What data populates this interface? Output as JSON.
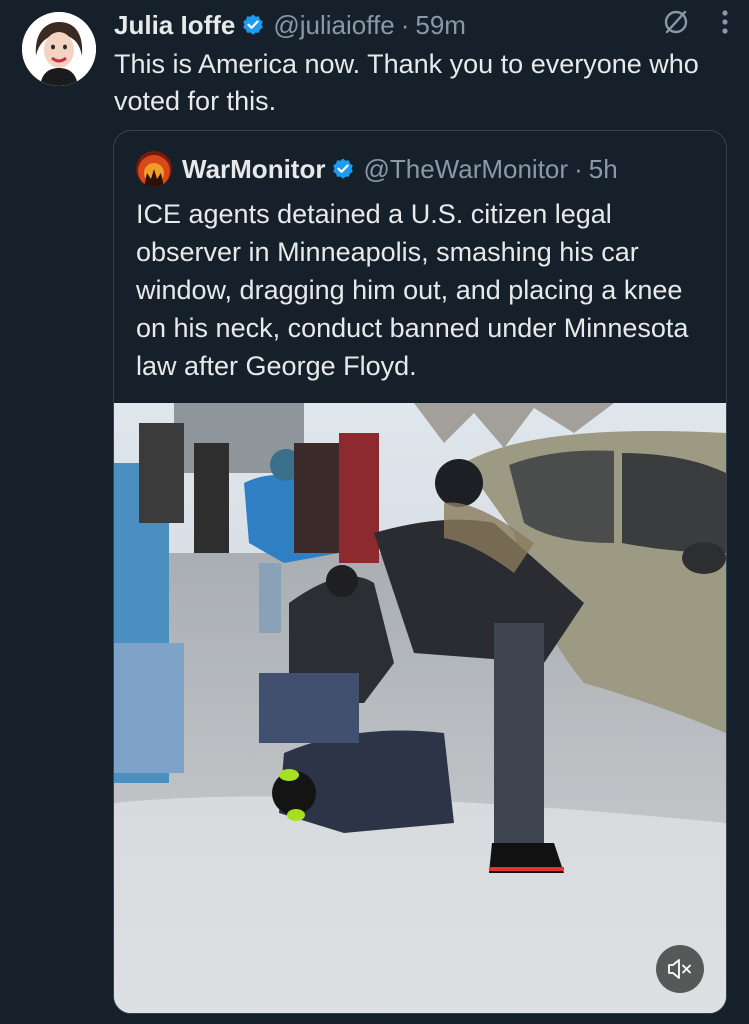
{
  "post": {
    "author_name": "Julia Ioffe",
    "author_handle": "@juliaioffe",
    "separator": "·",
    "time": "59m",
    "text": "This is America now. Thank you to everyone who voted for this."
  },
  "quote": {
    "author_name": "WarMonitor",
    "author_handle": "@TheWarMonitor",
    "separator": "·",
    "time": "5h",
    "text": "ICE agents detained a U.S. citizen legal observer in Minneapolis, smashing his car window, dragging him out, and placing a knee on his neck, conduct banned under Minnesota law after George Floyd."
  },
  "media": {
    "kind": "video",
    "muted": true
  },
  "icons": {
    "verified": "verified-badge-icon",
    "grok": "grok-icon",
    "more": "more-options-icon",
    "mute": "speaker-muted-icon"
  },
  "colors": {
    "background": "#15202b",
    "text_primary": "#e7e9ea",
    "text_secondary": "#8b98a5",
    "verified_blue": "#1d9bf0",
    "border": "#38444d"
  }
}
